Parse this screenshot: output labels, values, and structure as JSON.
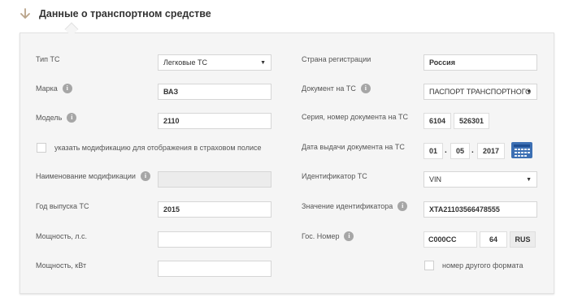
{
  "section": {
    "title": "Данные о транспортном средстве",
    "icon": "arrow-down-icon"
  },
  "left": {
    "vehicle_type": {
      "label": "Тип ТС",
      "value": "Легковые ТС"
    },
    "brand": {
      "label": "Марка",
      "value": "ВАЗ"
    },
    "model": {
      "label": "Модель",
      "value": "2110"
    },
    "modification_checkbox": {
      "label": "указать модификацию для отображения в страховом полисе",
      "checked": false
    },
    "modification_name": {
      "label": "Наименование модификации",
      "value": ""
    },
    "year": {
      "label": "Год выпуска ТС",
      "value": "2015"
    },
    "power_hp": {
      "label": "Мощность, л.с.",
      "value": ""
    },
    "power_kw": {
      "label": "Мощность, кВт",
      "value": ""
    }
  },
  "right": {
    "country": {
      "label": "Страна регистрации",
      "value": "Россия"
    },
    "document": {
      "label": "Документ на ТС",
      "value": "ПАСПОРТ ТРАНСПОРТНОГО"
    },
    "doc_series_number": {
      "label": "Серия, номер документа на ТС",
      "series": "6104",
      "number": "526301"
    },
    "doc_issue_date": {
      "label": "Дата выдачи документа на ТС",
      "day": "01",
      "month": "05",
      "year": "2017",
      "separator": "."
    },
    "identifier": {
      "label": "Идентификатор ТС",
      "value": "VIN"
    },
    "identifier_value": {
      "label": "Значение идентификатора",
      "value": "XTA21103566478555"
    },
    "plate": {
      "label": "Гос. Номер",
      "number": "С000СС",
      "region": "64",
      "country": "RUS"
    },
    "other_format": {
      "label": "номер другого формата",
      "checked": false
    }
  },
  "info_icon_glyph": "i",
  "caret_glyph": "▼"
}
